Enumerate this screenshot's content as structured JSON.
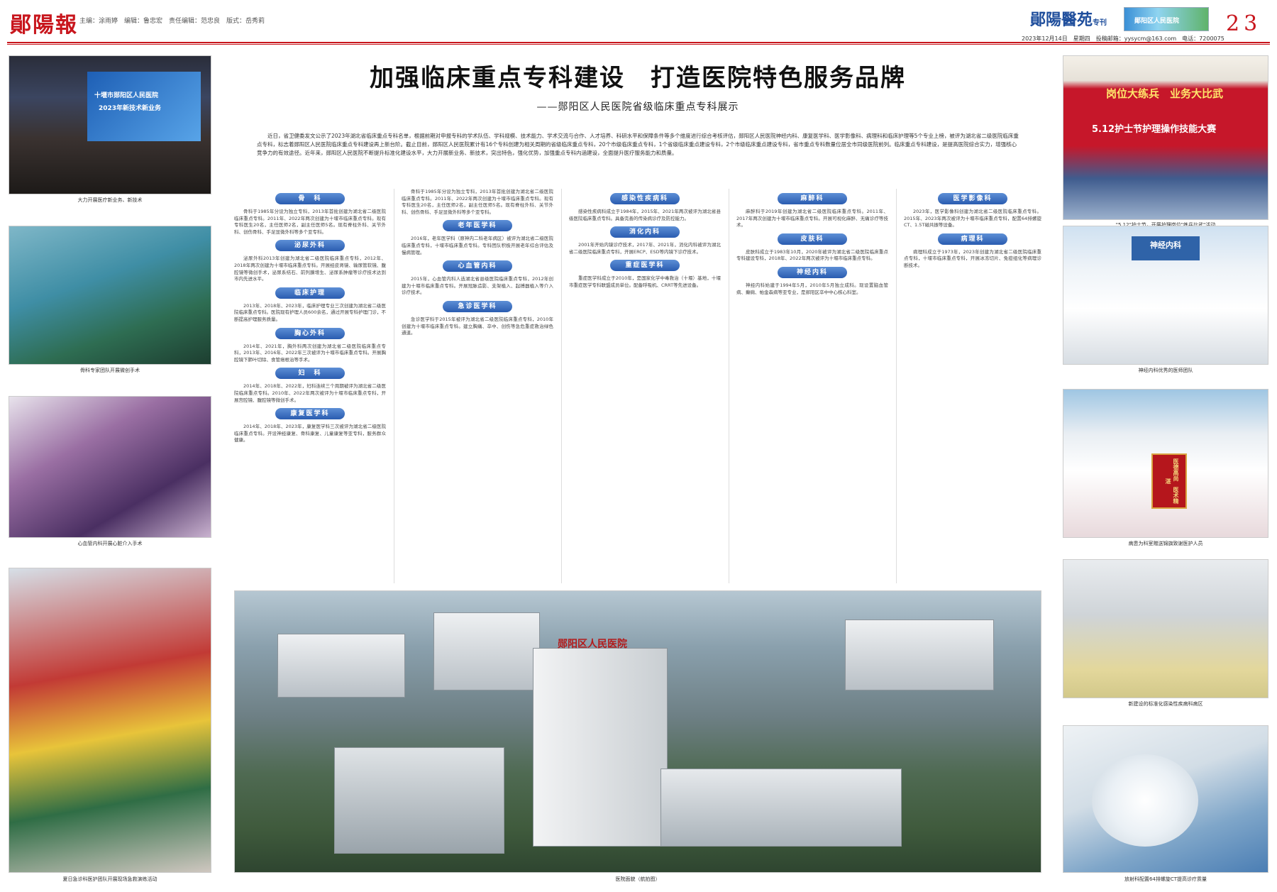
{
  "masthead": {
    "logo": "鄖陽報",
    "staff": "主编：涂雨婷　编辑：鲁忠宏　责任编辑：范忠良　版式：岳秀莉",
    "special_title": "鄖陽醫苑",
    "special_tag": "专刊",
    "header_image_text": "鄖阳区人民医院",
    "page_number": "23",
    "date_line": "2023年12月14日　星期四　投稿邮箱：yysycm@163.com　电话：7200075"
  },
  "article": {
    "headline": "加强临床重点专科建设　打造医院特色服务品牌",
    "subheadline": "——郧阳区人民医院省级临床重点专科展示",
    "intro": "近日，省卫健委发文公示了2023年湖北省临床重点专科名单，根据前期对申报专科的学术队伍、学科规模、技术能力、学术交流与合作、人才培养、科研水平和保障条件等多个维度进行综合考核评估，郧阳区人民医院神经内科、康复医学科、医学影像科、病理科和临床护理等5个专业上榜，被评为湖北省二级医院临床重点专科，标志着郧阳区人民医院临床重点专科建设再上新台阶。截止目前，郧阳区人民医院累计有16个专科创建为相关周期的省级临床重点专科，20个市级临床重点专科，1个省级临床重点建设专科，2个市级临床重点建设专科，省市重点专科数量位居全市同级医院前列。临床重点专科建设，是提高医院综合实力，增强核心竞争力的有效途径。近年来，郧阳区人民医院不断提升标准化建设水平，大力开展新业务、新技术，突出特色，强化优势，加强重点专科内涵建设，全面提升医疗服务能力和质量。"
  },
  "sections": [
    {
      "name": "骨　科",
      "body": "骨科于1985年分设为独立专科，2013年首批创建为湖北省二级医院临床重点专科。2011年、2022年两次创建为十堰市临床重点专科。现有专科医生20名，主任医师2名，副主任医师5名。现有脊柱外科、关节外科、创伤骨科、手足显微外科等多个亚专科。"
    },
    {
      "name": "泌尿外科",
      "body": "泌尿外科2013年创建为湖北省二级医院临床重点专科，2012年、2018年两次创建为十堰市临床重点专科。开展经皮肾镜、输尿管软镜、腹腔镜等微创手术，泌尿系结石、前列腺增生、泌尿系肿瘤等诊疗技术达到市内先进水平。"
    },
    {
      "name": "临床护理",
      "body": "2013年、2018年、2023年，临床护理专业三次创建为湖北省二级医院临床重点专科。医院现有护理人员600余名，通过开展专科护理门诊，不断提高护理服务质量。"
    },
    {
      "name": "胸心外科",
      "body": "2014年、2021年，胸外科两次创建为湖北省二级医院临床重点专科，2013年、2016年、2022年三次被评为十堰市临床重点专科。开展胸腔镜下肺叶切除、食管癌根治等手术。"
    },
    {
      "name": "妇　科",
      "body": "2014年、2018年、2022年，妇科连续三个周期被评为湖北省二级医院临床重点专科。2010年、2022年两次被评为十堰市临床重点专科，开展宫腔镜、腹腔镜等微创手术。"
    },
    {
      "name": "康复医学科",
      "body": "2014年、2018年、2023年，康复医学科三次被评为湖北省二级医院临床重点专科。开设神经康复、骨科康复、儿童康复等亚专科，服务群众健康。"
    },
    {
      "name": "老年医学科",
      "body": "2016年，老年医学科（原神内二科老年病区）被评为湖北省二级医院临床重点专科，十堰市临床重点专科。专科团队积极开展老年综合评估及慢病管理。"
    },
    {
      "name": "心血管内科",
      "body": "2015年，心血管内科人选湖北省县级医院临床重点专科，2012年创建为十堰市临床重点专科。开展冠脉造影、支架植入、起搏器植入等介入诊疗技术。"
    },
    {
      "name": "急诊医学科",
      "body": "急诊医学科于2015年被评为湖北省二级医院临床重点专科，2010年创建为十堰市临床重点专科。建立胸痛、卒中、创伤等急危重症救治绿色通道。"
    },
    {
      "name": "感染性疾病科",
      "body": "感染性疾病科成立于1984年，2015年、2021年两次被评为湖北省县级医院临床重点专科。具备完善的传染病诊疗及防控能力。"
    },
    {
      "name": "消化内科",
      "body": "2001年开始内镜诊疗技术，2017年、2021年，消化内科被评为湖北省二级医院临床重点专科，开展ERCP、ESD等内镜下诊疗技术。"
    },
    {
      "name": "重症医学科",
      "body": "重症医学科成立于2010年，是国家化学中毒救治（十堰）基地，十堰市重症医学专科联盟成员单位。配备呼吸机、CRRT等先进设备。"
    },
    {
      "name": "麻醉科",
      "body": "麻醉科于2019年创建为湖北省二级医院临床重点专科。2011年、2017年两次创建为十堰市临床重点专科。开展可视化麻醉、无痛诊疗等技术。"
    },
    {
      "name": "皮肤科",
      "body": "皮肤科成立于1983年10月，2020年被评为湖北省二级医院临床重点专科建设专科，2018年、2022年两次被评为十堰市临床重点专科。"
    },
    {
      "name": "神经内科",
      "body": "神经内科始建于1994年5月，2010年5月独立成科。现设置脑血管病、癫痫、帕金森病等亚专业，是郧阳区卒中中心核心科室。"
    },
    {
      "name": "医学影像科",
      "body": "2023年，医学影像科创建为湖北省二级医院临床重点专科。2015年、2023年两次被评为十堰市临床重点专科，配置64排螺旋CT、1.5T磁共振等设备。"
    },
    {
      "name": "病理科",
      "body": "病理科成立于1973年，2023年创建为湖北省二级医院临床重点专科，十堰市临床重点专科，开展冰冻切片、免疫组化等病理诊断技术。"
    }
  ],
  "photos": {
    "left1_screen": "十堰市郧阳区人民医院",
    "left1_screen2": "2023年新技术新业务",
    "left1_caption": "大力开展医疗新业务、新技术",
    "left2_caption": "骨科专家团队开展微创手术",
    "left3_caption": "心血管内科开展心脏介入手术",
    "left4_caption": "夏日急诊科医护团队开展现场急救演练活动",
    "right1_banner1": "岗位大练兵　业务大比武",
    "right1_banner2": "5.12护士节护理操作技能大赛",
    "right1_caption": "\"5.12\"护士节，开展护理岗位\"练兵比武\"活动",
    "right2_sign": "神经内科",
    "right2_caption": "神经内科优秀的医师团队",
    "right3_banner": "医德高尚　医术精湛",
    "right3_caption": "病患为科室赠送锦旗致谢医护人员",
    "right4_caption": "新建设的标准化感染性疾病科病区",
    "right5_caption": "放射科配置64排螺旋CT提高诊疗质量",
    "center_sign": "郧阳区人民医院",
    "center_caption": "医院面貌（航拍图）"
  },
  "colors": {
    "brand_red": "#c8161d",
    "pill_blue": "#2a5cb0",
    "special_blue": "#1f4e9c"
  }
}
